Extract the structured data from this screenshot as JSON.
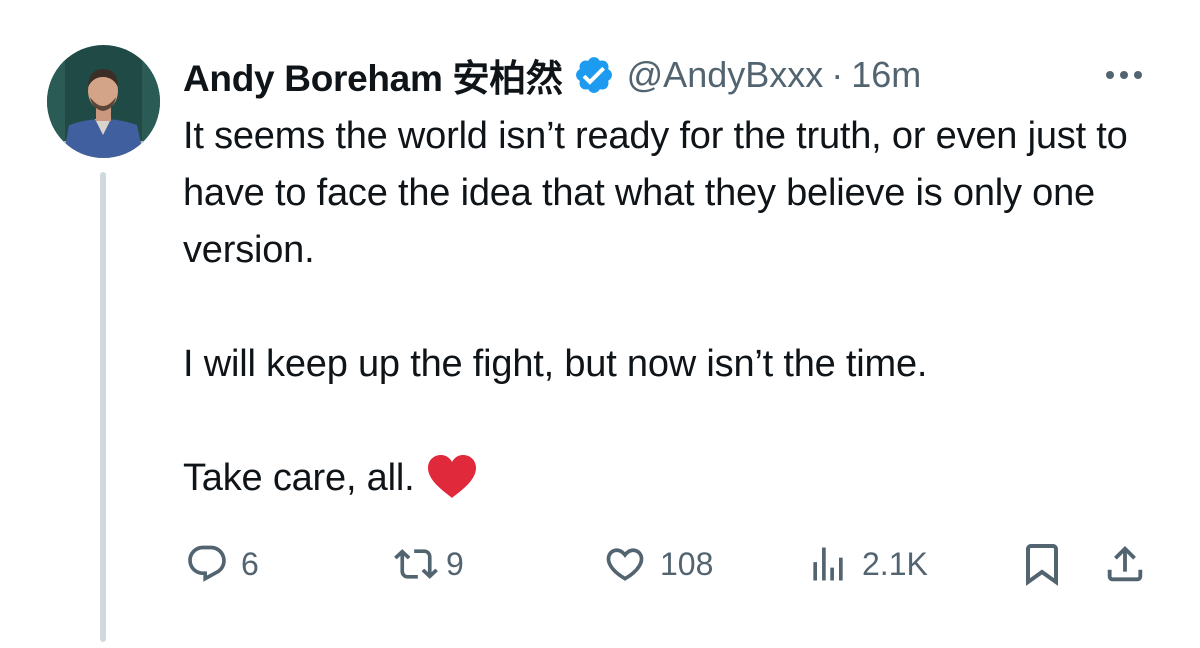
{
  "tweet": {
    "author": {
      "name": "Andy Boreham 安柏然",
      "handle": "@AndyBxxx",
      "verified": true
    },
    "separator": "·",
    "time": "16m",
    "paragraphs": [
      "It seems the world isn’t ready for the truth, or even just to have to face the idea that what they believe is only one version.",
      "I will keep up the fight, but now isn’t the time.",
      "Take care, all."
    ],
    "emoji": "heart-emoji"
  },
  "actions": {
    "replies": "6",
    "reposts": "9",
    "likes": "108",
    "views": "2.1K"
  },
  "icons": {
    "more": "more-horizontal-icon",
    "reply": "reply-icon",
    "repost": "repost-icon",
    "like": "like-icon",
    "views": "views-icon",
    "bookmark": "bookmark-icon",
    "share": "share-icon"
  },
  "colors": {
    "text": "#0f1419",
    "muted": "#536471",
    "verified": "#1d9bf0",
    "thread_line": "#cfd9de",
    "heart": "#e0293b"
  }
}
